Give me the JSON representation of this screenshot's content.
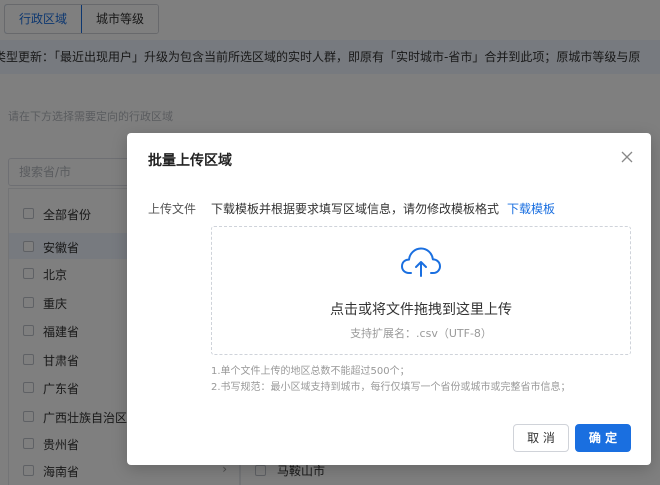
{
  "tabs": [
    {
      "label": "行政区域",
      "active": true
    },
    {
      "label": "城市等级",
      "active": false
    }
  ],
  "notice": "类型更新：「最近出现用户」升级为包含当前所选区域的实时人群，即原有「实时城市-省市」合并到此项；原城市等级与原",
  "region_hint": "请在下方选择需要定向的行政区域",
  "search": {
    "placeholder": "搜索省/市"
  },
  "province_list": {
    "all_label": "全部省份",
    "items": [
      "安徽省",
      "北京",
      "重庆",
      "福建省",
      "甘肃省",
      "广东省",
      "广西壮族自治区",
      "贵州省",
      "海南省"
    ]
  },
  "city_list": {
    "items": [
      "马鞍山市"
    ]
  },
  "modal": {
    "title": "批量上传区域",
    "field_label": "上传文件",
    "description": "下载模板并根据要求填写区域信息，请勿修改模板格式",
    "download_link": "下载模板",
    "drop_main": "点击或将文件拖拽到这里上传",
    "drop_sub": "支持扩展名：.csv（UTF-8）",
    "rule_1": "1.单个文件上传的地区总数不能超过500个；",
    "rule_2": "2.书写规范：最小区域支持到城市，每行仅填写一个省份或城市或完整省市信息；",
    "cancel_label": "取 消",
    "confirm_label": "确 定"
  },
  "colors": {
    "accent": "#1a6fe0",
    "notice_bg": "#eef4ff"
  }
}
